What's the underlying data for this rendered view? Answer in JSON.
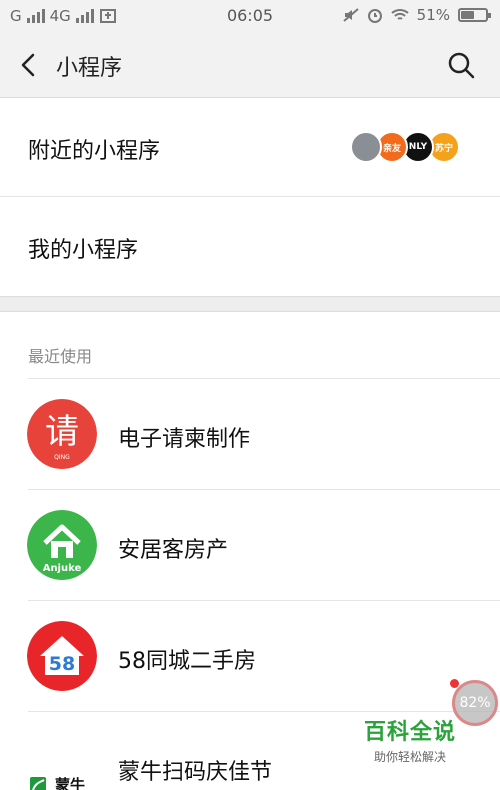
{
  "status_bar": {
    "network_1": "G",
    "network_2": "4G",
    "time": "06:05",
    "battery_text": "51%",
    "battery_level": 0.51
  },
  "nav": {
    "title": "小程序",
    "back_icon": "chevron-left-icon",
    "search_icon": "search-icon"
  },
  "entries": {
    "nearby_label": "附近的小程序",
    "mine_label": "我的小程序",
    "nearby_thumbs": [
      {
        "name": "building-thumb",
        "color": "#8a8f95",
        "text": ""
      },
      {
        "name": "orange-logo-thumb",
        "color": "#f26a1b",
        "text": "亲友"
      },
      {
        "name": "only-logo-thumb",
        "color": "#111111",
        "text": "NLY"
      },
      {
        "name": "fox-logo-thumb",
        "color": "#f4a21c",
        "text": "苏宁"
      }
    ]
  },
  "recent": {
    "title": "最近使用",
    "apps": [
      {
        "name": "电子请柬制作",
        "icon_char": "请",
        "icon_sub": "QING",
        "color": "#e8433a"
      },
      {
        "name": "安居客房产",
        "icon_text": "Anjuke",
        "color": "#3cb64a"
      },
      {
        "name": "58同城二手房",
        "icon_text": "58",
        "color": "#e8262a"
      },
      {
        "name": "蒙牛扫码庆佳节",
        "icon_text": "蒙牛",
        "color": "#1e9a3b"
      }
    ]
  },
  "overlay": {
    "percent": "82%",
    "watermark_main": "百科全说",
    "watermark_sub": "助你轻松解决"
  }
}
